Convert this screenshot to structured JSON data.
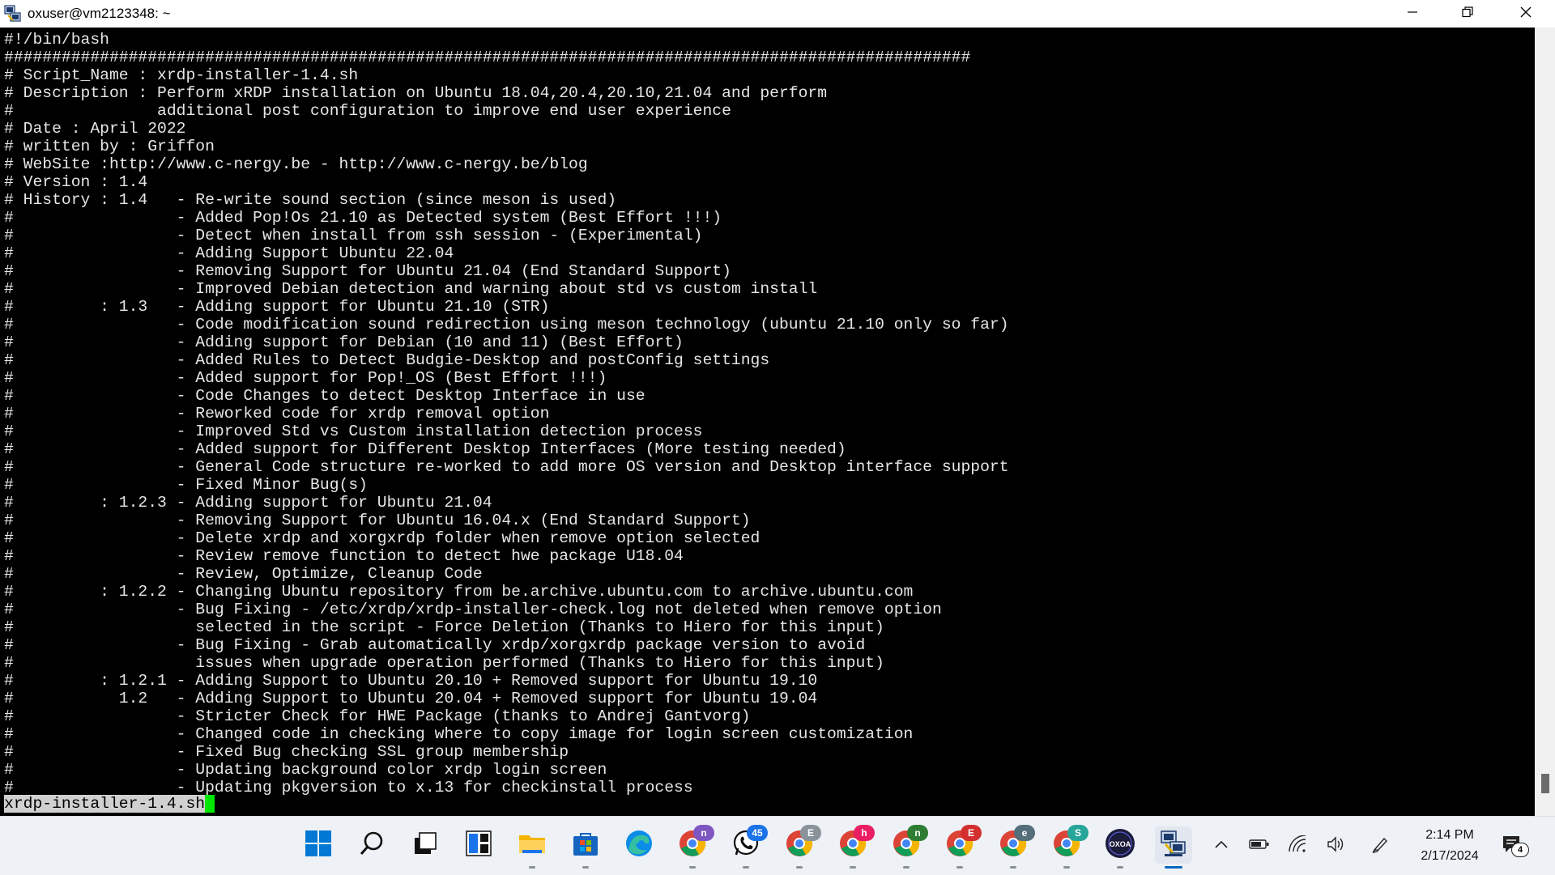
{
  "window": {
    "title": "oxuser@vm2123348: ~"
  },
  "terminal": {
    "lines": [
      "#!/bin/bash",
      "#####################################################################################################",
      "# Script_Name : xrdp-installer-1.4.sh",
      "# Description : Perform xRDP installation on Ubuntu 18.04,20.4,20.10,21.04 and perform",
      "#               additional post configuration to improve end user experience",
      "# Date : April 2022",
      "# written by : Griffon",
      "# WebSite :http://www.c-nergy.be - http://www.c-nergy.be/blog",
      "# Version : 1.4",
      "# History : 1.4   - Re-write sound section (since meson is used)",
      "#                 - Added Pop!Os 21.10 as Detected system (Best Effort !!!)",
      "#                 - Detect when install from ssh session - (Experimental)",
      "#                 - Adding Support Ubuntu 22.04",
      "#                 - Removing Support for Ubuntu 21.04 (End Standard Support)",
      "#                 - Improved Debian detection and warning about std vs custom install",
      "#         : 1.3   - Adding support for Ubuntu 21.10 (STR)",
      "#                 - Code modification sound redirection using meson technology (ubuntu 21.10 only so far)",
      "#                 - Adding support for Debian (10 and 11) (Best Effort)",
      "#                 - Added Rules to Detect Budgie-Desktop and postConfig settings",
      "#                 - Added support for Pop!_OS (Best Effort !!!)",
      "#                 - Code Changes to detect Desktop Interface in use",
      "#                 - Reworked code for xrdp removal option",
      "#                 - Improved Std vs Custom installation detection process",
      "#                 - Added support for Different Desktop Interfaces (More testing needed)",
      "#                 - General Code structure re-worked to add more OS version and Desktop interface support",
      "#                 - Fixed Minor Bug(s)",
      "#         : 1.2.3 - Adding support for Ubuntu 21.04",
      "#                 - Removing Support for Ubuntu 16.04.x (End Standard Support)",
      "#                 - Delete xrdp and xorgxrdp folder when remove option selected",
      "#                 - Review remove function to detect hwe package U18.04",
      "#                 - Review, Optimize, Cleanup Code",
      "#         : 1.2.2 - Changing Ubuntu repository from be.archive.ubuntu.com to archive.ubuntu.com",
      "#                 - Bug Fixing - /etc/xrdp/xrdp-installer-check.log not deleted when remove option",
      "#                   selected in the script - Force Deletion (Thanks to Hiero for this input)",
      "#                 - Bug Fixing - Grab automatically xrdp/xorgxrdp package version to avoid",
      "#                   issues when upgrade operation performed (Thanks to Hiero for this input)",
      "#         : 1.2.1 - Adding Support to Ubuntu 20.10 + Removed support for Ubuntu 19.10",
      "#           1.2   - Adding Support to Ubuntu 20.04 + Removed support for Ubuntu 19.04",
      "#                 - Stricter Check for HWE Package (thanks to Andrej Gantvorg)",
      "#                 - Changed code in checking where to copy image for login screen customization",
      "#                 - Fixed Bug checking SSL group membership",
      "#                 - Updating background color xrdp login screen",
      "#                 - Updating pkgversion to x.13 for checkinstall process"
    ],
    "status_filename": "xrdp-installer-1.4.sh"
  },
  "taskbar": {
    "items": [
      {
        "name": "start-button",
        "icon": "windows-logo-icon"
      },
      {
        "name": "search-button",
        "icon": "search-icon"
      },
      {
        "name": "task-view-button",
        "icon": "task-view-icon"
      },
      {
        "name": "widgets-button",
        "icon": "widgets-icon"
      },
      {
        "name": "file-explorer-button",
        "icon": "folder-icon"
      },
      {
        "name": "microsoft-store-button",
        "icon": "store-icon"
      },
      {
        "name": "edge-button",
        "icon": "edge-icon"
      },
      {
        "name": "chrome-profile-n-button",
        "icon": "chrome-icon",
        "badge": "n",
        "badge_color": "#7e57c2"
      },
      {
        "name": "whatsapp-button",
        "icon": "whatsapp-icon",
        "badge": "45",
        "badge_color": "#1a73e8"
      },
      {
        "name": "chrome-profile-e-gray-button",
        "icon": "chrome-icon",
        "badge": "E",
        "badge_color": "#8a9399"
      },
      {
        "name": "chrome-profile-h-button",
        "icon": "chrome-icon",
        "badge": "h",
        "badge_color": "#e91e63"
      },
      {
        "name": "chrome-profile-n-green-button",
        "icon": "chrome-icon",
        "badge": "n",
        "badge_color": "#2e7d32"
      },
      {
        "name": "chrome-profile-e-red-button",
        "icon": "chrome-icon",
        "badge": "E",
        "badge_color": "#d32f2f"
      },
      {
        "name": "chrome-profile-e-dark-button",
        "icon": "chrome-icon",
        "badge": "e",
        "badge_color": "#546e7a"
      },
      {
        "name": "chrome-profile-s-button",
        "icon": "chrome-icon",
        "badge": "S",
        "badge_color": "#26a69a"
      },
      {
        "name": "oxoa-app-button",
        "icon": "oxoa-icon",
        "label": "OXOA"
      },
      {
        "name": "putty-button",
        "icon": "putty-icon"
      }
    ],
    "tray": {
      "clock_time": "2:14 PM",
      "clock_date": "2/17/2024",
      "notification_count": "4"
    }
  },
  "colors": {
    "terminal_bg": "#000000",
    "terminal_fg": "#e6e6e6",
    "cursor": "#00e600",
    "taskbar_bg": "#eef1f6",
    "accent": "#0067c0"
  }
}
